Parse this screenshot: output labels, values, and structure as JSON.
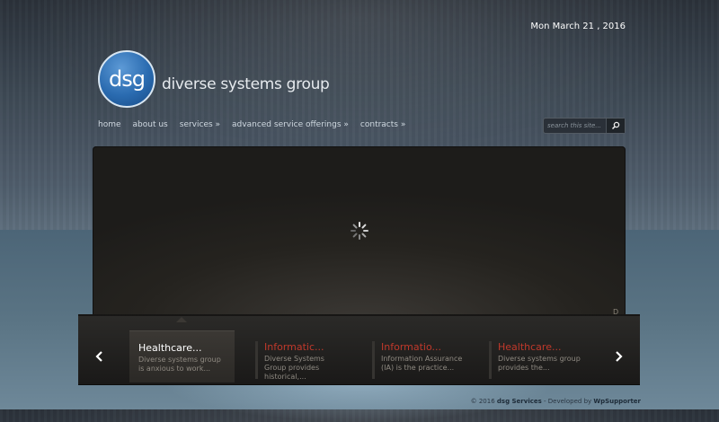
{
  "header": {
    "date": "Mon March 21 , 2016",
    "logo_mark": "dsg",
    "logo_text": "diverse systems group"
  },
  "nav": {
    "items": [
      {
        "label": "home"
      },
      {
        "label": "about us"
      },
      {
        "label": "services »"
      },
      {
        "label": "advanced service offerings »"
      },
      {
        "label": "contracts »"
      }
    ]
  },
  "search": {
    "placeholder": "search this site...",
    "button_icon": "magnifier-icon"
  },
  "stage": {
    "status_icon": "loading-spinner-icon",
    "corner_mark": "D"
  },
  "carousel": {
    "prev_icon": "chevron-left-icon",
    "next_icon": "chevron-right-icon",
    "slides": [
      {
        "title": "Healthcare...",
        "desc": "Diverse systems group is anxious to work..."
      },
      {
        "title": "Informatic...",
        "desc": "Diverse Systems Group provides historical,..."
      },
      {
        "title": "Informatio...",
        "desc": "Information Assurance (IA) is the practice..."
      },
      {
        "title": "Healthcare...",
        "desc": "Diverse systems group provides the..."
      }
    ]
  },
  "footer": {
    "prefix": "© 2016",
    "site": "dsg Services",
    "middle": "- Developed by",
    "developer": "WpSupporter"
  },
  "colors": {
    "accent_red": "#c0392b",
    "logo_blue": "#2a6bb0"
  }
}
